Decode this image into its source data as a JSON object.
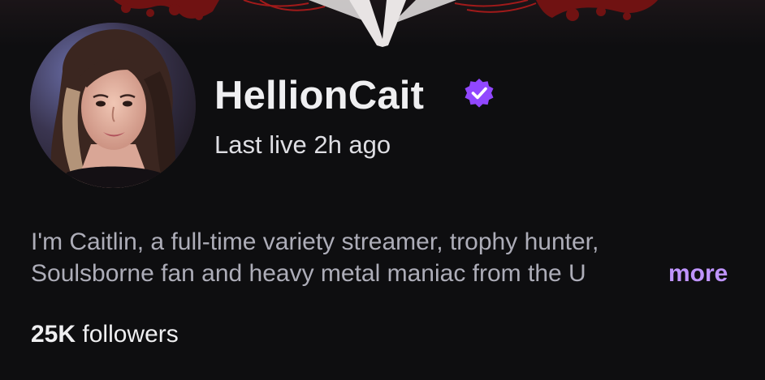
{
  "channel": {
    "name": "HellionCait",
    "verified": true,
    "last_live": "Last live 2h ago"
  },
  "bio": {
    "line1": "I'm Caitlin, a full-time variety streamer, trophy hunter,",
    "line2": "Soulsborne fan and heavy metal maniac from the U",
    "more_label": "more"
  },
  "followers": {
    "count": "25K",
    "label": "followers"
  },
  "colors": {
    "background": "#0e0e10",
    "accent": "#bf94ff",
    "verified_badge": "#9147ff",
    "banner_red": "#8a1414"
  },
  "icons": {
    "verified": "verified-badge-icon"
  }
}
